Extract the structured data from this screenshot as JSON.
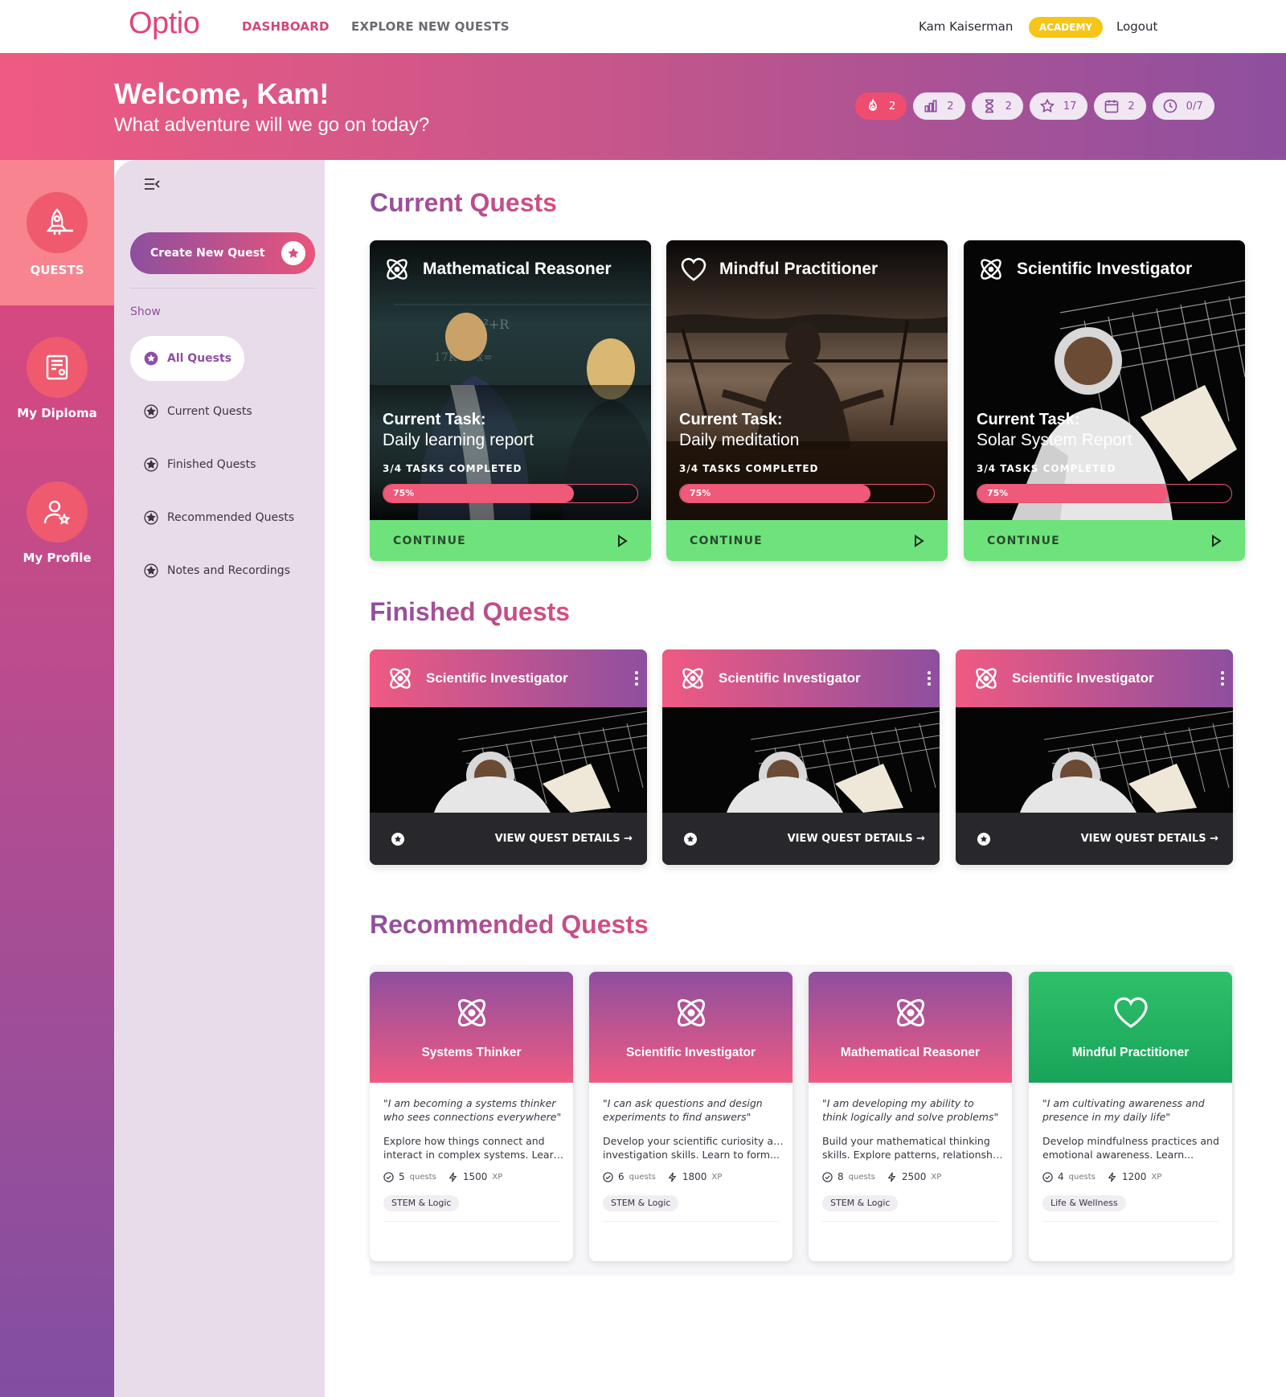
{
  "nav": {
    "logo": "Optio",
    "dashboard": "DASHBOARD",
    "explore": "EXPLORE NEW QUESTS",
    "user_name": "Kam Kaiserman",
    "badge": "ACADEMY",
    "logout": "Logout"
  },
  "banner": {
    "title": "Welcome, Kam!",
    "subtitle": "What adventure will we go on today?",
    "stats": [
      {
        "icon": "flame-icon",
        "value": "2"
      },
      {
        "icon": "bar-chart-icon",
        "value": "2"
      },
      {
        "icon": "hourglass-icon",
        "value": "2"
      },
      {
        "icon": "star-icon",
        "value": "17"
      },
      {
        "icon": "calendar-icon",
        "value": "2"
      },
      {
        "icon": "clock-icon",
        "value": "0/7"
      }
    ]
  },
  "rail": {
    "quests": "QUESTS",
    "diploma": "My Diploma",
    "profile": "My Profile"
  },
  "panel": {
    "create_button": "Create New Quest",
    "show_label": "Show",
    "filters": [
      "All Quests",
      "Current Quests",
      "Finished Quests",
      "Recommended Quests",
      "Notes and Recordings"
    ]
  },
  "current": {
    "title": "Current Quests",
    "cards": [
      {
        "name": "Mathematical Reasoner",
        "icon": "atom-icon",
        "task_label": "Current Task:",
        "task": "Daily learning report",
        "progress_text": "3/4 TASKS COMPLETED",
        "percent_label": "75%",
        "percent": 0.75,
        "cta": "CONTINUE"
      },
      {
        "name": "Mindful Practitioner",
        "icon": "heart-icon",
        "task_label": "Current Task:",
        "task": "Daily meditation",
        "progress_text": "3/4 TASKS COMPLETED",
        "percent_label": "75%",
        "percent": 0.75,
        "cta": "CONTINUE"
      },
      {
        "name": "Scientific Investigator",
        "icon": "atom-icon",
        "task_label": "Current Task:",
        "task": "Solar System Report",
        "progress_text": "3/4 TASKS COMPLETED",
        "percent_label": "75%",
        "percent": 0.75,
        "cta": "CONTINUE"
      }
    ]
  },
  "finished": {
    "title": "Finished Quests",
    "cards": [
      {
        "name": "Scientific Investigator",
        "cta": "VIEW QUEST DETAILS →"
      },
      {
        "name": "Scientific Investigator",
        "cta": "VIEW QUEST DETAILS →"
      },
      {
        "name": "Scientific Investigator",
        "cta": "VIEW QUEST DETAILS →"
      }
    ]
  },
  "recommended": {
    "title": "Recommended Quests",
    "cards": [
      {
        "name": "Systems Thinker",
        "icon": "atom-icon",
        "quote": "\"I am becoming a systems thinker who sees connections everywhere\"",
        "desc1": "Explore how things connect and",
        "desc2": "interact in complex systems. Learn...",
        "quests": "5",
        "quests_label": "quests",
        "xp": "1500",
        "xp_label": "XP",
        "tag": "STEM & Logic"
      },
      {
        "name": "Scientific Investigator",
        "icon": "atom-icon",
        "quote": "\"I can ask questions and design experiments to find answers\"",
        "desc1": "Develop your scientific curiosity and",
        "desc2": "investigation skills. Learn to form...",
        "quests": "6",
        "quests_label": "quests",
        "xp": "1800",
        "xp_label": "XP",
        "tag": "STEM & Logic"
      },
      {
        "name": "Mathematical Reasoner",
        "icon": "atom-icon",
        "quote": "\"I am developing my ability to think logically and solve problems\"",
        "desc1": "Build your mathematical thinking",
        "desc2": "skills. Explore patterns, relationship...",
        "quests": "8",
        "quests_label": "quests",
        "xp": "2500",
        "xp_label": "XP",
        "tag": "STEM & Logic"
      },
      {
        "name": "Mindful Practitioner",
        "icon": "heart-icon",
        "quote": "\"I am cultivating awareness and presence in my daily life\"",
        "desc1": "Develop mindfulness practices and",
        "desc2": "emotional awareness. Learn...",
        "quests": "4",
        "quests_label": "quests",
        "xp": "1200",
        "xp_label": "XP",
        "tag": "Life & Wellness"
      }
    ]
  },
  "colors": {
    "brand_pink": "#e0447a",
    "brand_purple": "#8e4f9f",
    "continue_green": "#6ee37c",
    "badge_yellow": "#f5c518"
  }
}
